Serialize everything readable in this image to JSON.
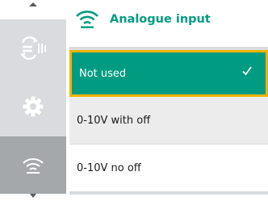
{
  "header": {
    "title": "Analogue input",
    "icon": "wireless-signal-icon"
  },
  "sidebar": {
    "items": [
      {
        "icon": "mode-arrows-icon"
      },
      {
        "icon": "gear-icon"
      },
      {
        "icon": "wireless-signal-icon",
        "active": true
      }
    ]
  },
  "menu": {
    "items": [
      {
        "label": "Not used",
        "selected": true
      },
      {
        "label": "0-10V with off",
        "selected": false
      },
      {
        "label": "0-10V no off",
        "selected": false
      }
    ]
  },
  "colors": {
    "accent": "#009c82",
    "focus_border": "#f0b400",
    "sidebar_bg": "#d9dbde",
    "sidebar_active": "#a5a8ab"
  }
}
